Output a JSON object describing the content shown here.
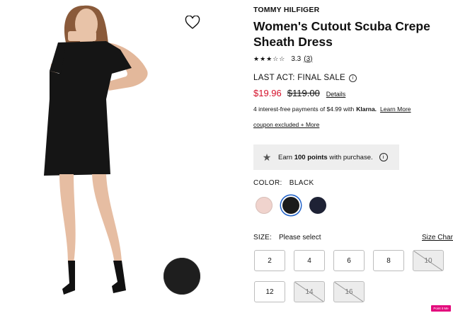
{
  "product": {
    "brand": "TOMMY HILFIGER",
    "title": "Women's Cutout Scuba Crepe Sheath Dress",
    "rating_stars": "★★★☆☆",
    "rating_value": "3.3",
    "rating_count": "(3)",
    "final_sale": "LAST ACT: FINAL SALE",
    "sale_price": "$19.96",
    "original_price": "$119.00",
    "details_label": "Details",
    "klarna_text": "4 interest-free payments of $4.99 with",
    "klarna_brand": "Klarna.",
    "learn_more": "Learn More",
    "coupon_text": "coupon excluded + More",
    "points_prefix": "Earn",
    "points_bold": "100 points",
    "points_suffix": "with purchase."
  },
  "color": {
    "label": "COLOR:",
    "selected": "BLACK",
    "swatches": [
      "#f0d3cd",
      "#1b1b1b",
      "#1e2235"
    ]
  },
  "size": {
    "label": "SIZE:",
    "placeholder": "Please select",
    "chart_label": "Size Chart",
    "options": [
      {
        "label": "2",
        "available": true
      },
      {
        "label": "4",
        "available": true
      },
      {
        "label": "6",
        "available": true
      },
      {
        "label": "8",
        "available": true
      },
      {
        "label": "10",
        "available": false
      },
      {
        "label": "12",
        "available": true
      },
      {
        "label": "14",
        "available": false
      },
      {
        "label": "16",
        "available": false
      }
    ]
  },
  "badge": "Point it Me",
  "colors": {
    "sale_red": "#d40f29",
    "selected_ring": "#1e60c8",
    "points_bg": "#eeeeee"
  }
}
